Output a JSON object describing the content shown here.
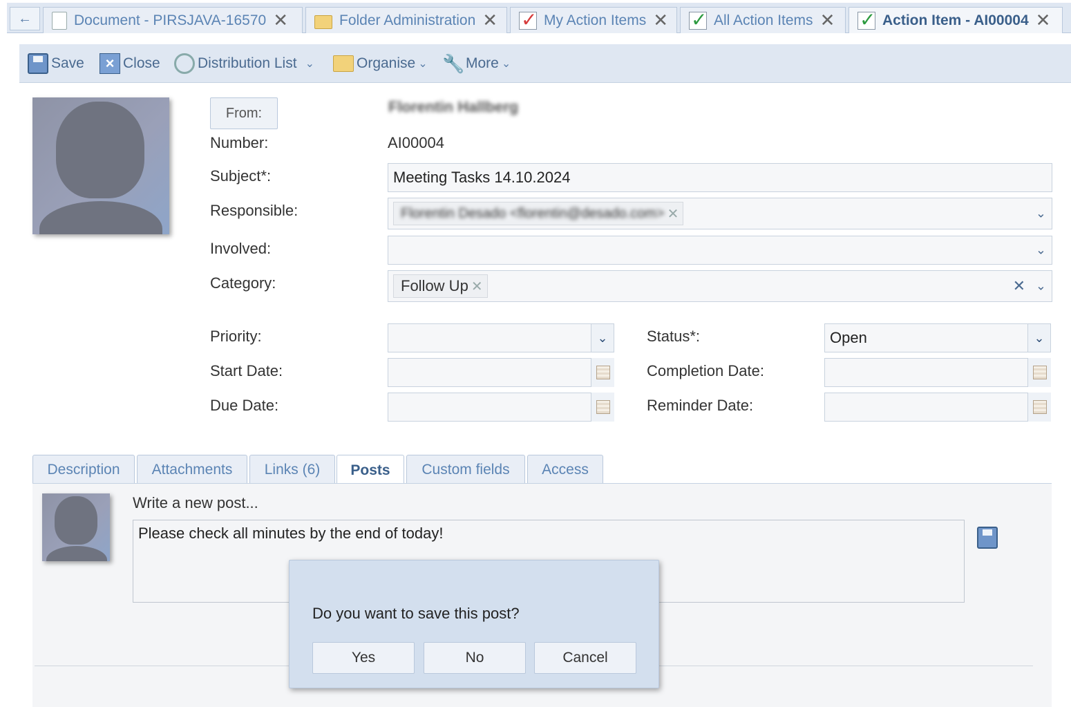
{
  "tabs": [
    {
      "label": "Document - PIRSJAVA-16570",
      "icon": "document-icon"
    },
    {
      "label": "Folder Administration",
      "icon": "folder-icon"
    },
    {
      "label": "My Action Items",
      "icon": "checkbox-red-icon"
    },
    {
      "label": "All Action Items",
      "icon": "checkbox-green-icon"
    },
    {
      "label": "Action Item - AI00004",
      "icon": "checkbox-green-icon",
      "active": true
    }
  ],
  "toolbar": {
    "save": "Save",
    "close": "Close",
    "distribution_list": "Distribution List",
    "organise": "Organise",
    "more": "More"
  },
  "form": {
    "from_label": "From:",
    "from_value": "Florentin Hallberg",
    "number_label": "Number:",
    "number_value": "AI00004",
    "subject_label": "Subject*:",
    "subject_value": "Meeting Tasks 14.10.2024",
    "responsible_label": "Responsible:",
    "responsible_value": "Florentin Desado <florentin@desado.com>",
    "involved_label": "Involved:",
    "category_label": "Category:",
    "category_value": "Follow Up",
    "priority_label": "Priority:",
    "status_label": "Status*:",
    "status_value": "Open",
    "start_date_label": "Start Date:",
    "completion_date_label": "Completion Date:",
    "due_date_label": "Due Date:",
    "reminder_date_label": "Reminder Date:"
  },
  "detail_tabs": [
    {
      "label": "Description"
    },
    {
      "label": "Attachments"
    },
    {
      "label": "Links (6)"
    },
    {
      "label": "Posts",
      "active": true
    },
    {
      "label": "Custom fields"
    },
    {
      "label": "Access"
    }
  ],
  "posts": {
    "heading": "Write a new post...",
    "text": "Please check all minutes by the end of today!"
  },
  "dialog": {
    "message": "Do you want to save this post?",
    "yes": "Yes",
    "no": "No",
    "cancel": "Cancel"
  },
  "colors": {
    "accent": "#5b84b4",
    "panel": "#dfe7f2",
    "dialog": "#d3dfee"
  }
}
